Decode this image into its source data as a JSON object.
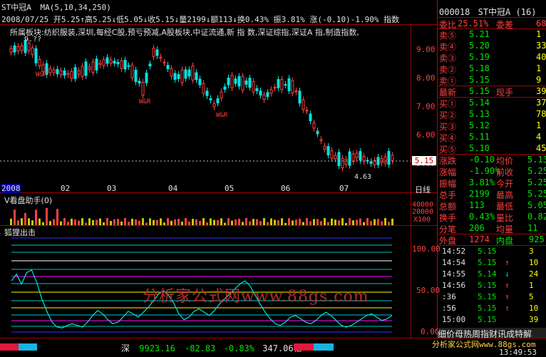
{
  "header": {
    "stock_name": "ST中冠A",
    "ma_label": "MA(5,10,34,250)",
    "quote_line": "2008/07/25 开5.25↑高5.25↓低5.05↓收5.15↓量2199↓额113↓换0.43% 振3.81% 涨(-0.10)-1.90% 指数",
    "sector_line": "所属板块:纺织服装,深圳,每经C股,预亏预减,A股板块,中证流通,新 指 数,深证综指,深证A 指,制造指数,"
  },
  "main_chart": {
    "y_ticks": [
      "9.00",
      "8.00",
      "7.00",
      "6.00",
      "5.00"
    ],
    "price_marker": "5.15",
    "low_label": "4.63",
    "high_label": "9.??",
    "wr_labels": [
      "W&R",
      "W&R",
      "W&R"
    ],
    "x_labels": [
      "2008",
      "02",
      "03",
      "04",
      "05",
      "06",
      "07"
    ],
    "period_label": "日线"
  },
  "volume_panel": {
    "title": "V看盘助手(0)",
    "y_ticks": [
      "40000",
      "20000",
      "X100"
    ]
  },
  "indicator_panel": {
    "title": "狐狸出击",
    "y_ticks": [
      "100.00",
      "50.00",
      "0.00"
    ],
    "values": [
      62,
      70,
      58,
      72,
      75,
      60,
      40,
      25,
      12,
      6,
      5,
      8,
      10,
      8,
      6,
      12,
      20,
      26,
      22,
      15,
      10,
      12,
      18,
      25,
      22,
      18,
      24,
      30,
      38,
      46,
      50,
      44,
      35,
      22,
      15,
      18,
      25,
      28,
      24,
      20,
      26,
      34,
      40,
      46,
      52,
      58,
      62,
      56,
      45,
      34,
      24,
      16,
      10,
      8,
      12,
      18,
      20,
      16,
      12,
      10,
      14,
      20,
      24,
      20,
      14,
      8,
      6,
      8,
      12,
      16,
      20,
      22,
      18,
      14,
      16,
      20
    ]
  },
  "watermark": "分析家公式网www.88gs.com",
  "quote_panel": {
    "code": "000018",
    "name": "ST中冠A",
    "count": "(16)",
    "weibi_label": "委比",
    "weibi_value": "25.51%",
    "weicha_label": "委差",
    "weicha_value": "68",
    "sells": [
      {
        "label": "卖⑤",
        "price": "5.21",
        "vol": "1"
      },
      {
        "label": "卖④",
        "price": "5.20",
        "vol": "33"
      },
      {
        "label": "卖③",
        "price": "5.19",
        "vol": "40"
      },
      {
        "label": "卖②",
        "price": "5.18",
        "vol": "1"
      },
      {
        "label": "卖①",
        "price": "5.15",
        "vol": "9"
      }
    ],
    "latest_label": "最新",
    "latest_price": "5.15",
    "xianshou_label": "现手",
    "xianshou_value": "39",
    "buys": [
      {
        "label": "买①",
        "price": "5.14",
        "vol": "37"
      },
      {
        "label": "买②",
        "price": "5.13",
        "vol": "78"
      },
      {
        "label": "买③",
        "price": "5.12",
        "vol": "1"
      },
      {
        "label": "买④",
        "price": "5.11",
        "vol": "4"
      },
      {
        "label": "买⑤",
        "price": "5.10",
        "vol": "45"
      }
    ],
    "stats": [
      {
        "l1": "涨跌",
        "v1": "-0.10",
        "l2": "均价",
        "v2": "5.13"
      },
      {
        "l1": "涨幅",
        "v1": "-1.90%",
        "l2": "前收",
        "v2": "5.25"
      },
      {
        "l1": "振幅",
        "v1": "3.81%",
        "l2": "今开",
        "v2": "5.25"
      },
      {
        "l1": "总手",
        "v1": "2199",
        "l2": "最高",
        "v2": "5.25"
      },
      {
        "l1": "总额",
        "v1": "113",
        "l2": "最低",
        "v2": "5.05"
      },
      {
        "l1": "换手",
        "v1": "0.43%",
        "l2": "量比",
        "v2": "0.82"
      },
      {
        "l1": "分笔",
        "v1": "206",
        "l2": "均量",
        "v2": "11"
      }
    ],
    "waipan_label": "外盘",
    "waipan_value": "1274",
    "neipan_label": "内盘",
    "neipan_value": "925",
    "ticks": [
      {
        "time": "14:52",
        "price": "5.15",
        "arrow": "",
        "vol": "3"
      },
      {
        "time": "14:54",
        "price": "5.15",
        "arrow": "↑",
        "vol": "10"
      },
      {
        "time": "14:55",
        "price": "5.14",
        "arrow": "↓",
        "vol": "24"
      },
      {
        "time": "14:56",
        "price": "5.15",
        "arrow": "↑",
        "vol": "1"
      },
      {
        "time": ":36",
        "price": "5.15",
        "arrow": "↑",
        "vol": "5"
      },
      {
        "time": ":56",
        "price": "5.15",
        "arrow": "↑",
        "vol": "10"
      },
      {
        "time": "15:00",
        "price": "5.15",
        "arrow": "",
        "vol": "39"
      }
    ],
    "ticker_text": "细价母热周指财讯成特解"
  },
  "status_bar": {
    "index_name": "深",
    "index_value": "9923.16",
    "index_change": "-82.83",
    "index_pct": "-0.83%",
    "index_amount": "347.06亿",
    "right_text": "分析家公式网www.88gs.com",
    "clock": "13:49:53"
  },
  "colors": {
    "up": "#ff4040",
    "down": "#00e4e4",
    "grid": "#a00000",
    "accent": "#ffff00"
  }
}
